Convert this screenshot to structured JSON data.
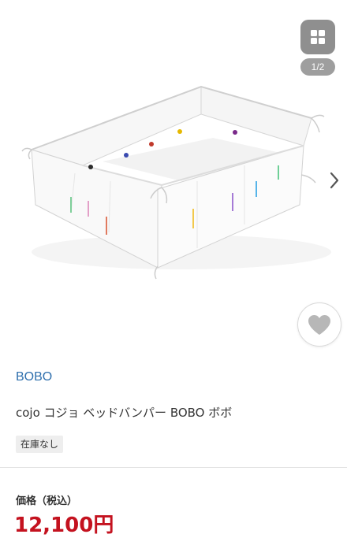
{
  "gallery": {
    "counter": "1/2",
    "icons": {
      "grid": "grid-icon",
      "next": "chevron-right-icon",
      "favorite": "heart-icon"
    }
  },
  "product": {
    "brand": "BOBO",
    "name": "cojo コジョ ベッドバンパー BOBO ボボ",
    "stock": "在庫なし",
    "price_label": "価格（税込）",
    "price": "12,100円"
  },
  "colors": {
    "brand_link": "#2e6fad",
    "price": "#c4121f",
    "badge_bg": "#eeeeee"
  }
}
